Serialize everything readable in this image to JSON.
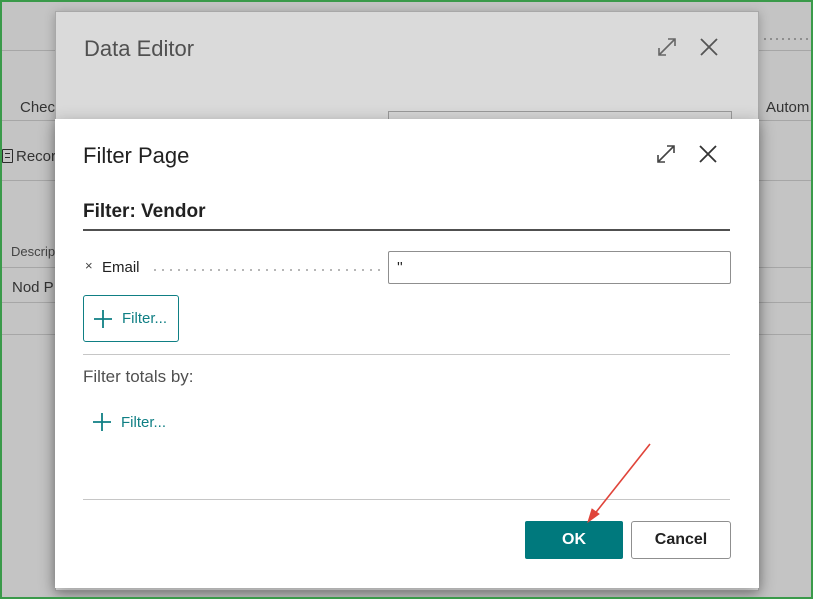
{
  "background": {
    "texts": [
      "Chec",
      "Recor",
      "Descrip",
      "Nod P",
      "Autom"
    ]
  },
  "data_editor": {
    "title": "Data Editor",
    "icons": {
      "expand": "expand-icon",
      "close": "close-icon"
    }
  },
  "filter_page": {
    "title": "Filter Page",
    "subtitle": "Filter: Vendor",
    "filter_row": {
      "remove_icon": "×",
      "field_label": "Email",
      "value": "''"
    },
    "add_filter_label": "Filter...",
    "totals_label": "Filter totals by:",
    "add_totals_filter_label": "Filter...",
    "ok_label": "OK",
    "cancel_label": "Cancel",
    "icons": {
      "expand": "expand-icon",
      "close": "close-icon",
      "add": "plus-icon"
    }
  },
  "colors": {
    "accent": "#00797d",
    "annotation_arrow": "#e0443a"
  }
}
